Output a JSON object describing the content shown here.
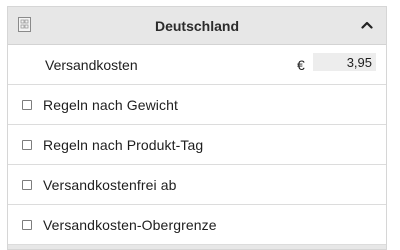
{
  "header": {
    "title": "Deutschland",
    "flag_icon": "flag-icon",
    "collapse_icon": "chevron-up-icon"
  },
  "shipping": {
    "label": "Versandkosten",
    "currency": "€",
    "value": "3,95"
  },
  "options": [
    {
      "label": "Regeln nach Gewicht",
      "checked": false
    },
    {
      "label": "Regeln nach Produkt-Tag",
      "checked": false
    },
    {
      "label": "Versandkostenfrei ab",
      "checked": false
    },
    {
      "label": "Versandkosten-Obergrenze",
      "checked": false
    }
  ],
  "colors": {
    "header_bg": "#e7e7e7",
    "border": "#dcdcdc",
    "input_bg": "#ededed"
  }
}
